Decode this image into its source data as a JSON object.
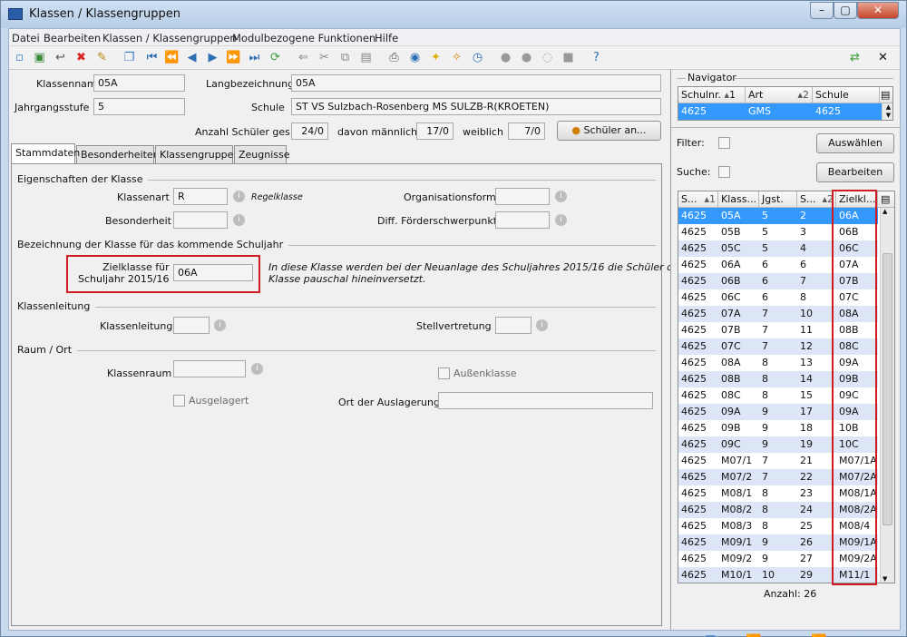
{
  "window": {
    "title": "Klassen / Klassengruppen"
  },
  "menu": [
    "Datei",
    "Bearbeiten",
    "Klassen / Klassengruppen",
    "Modulbezogene Funktionen",
    "Hilfe"
  ],
  "header": {
    "klassenname_label": "Klassenname",
    "klassenname": "05A",
    "langbezeichnung_label": "Langbezeichnung",
    "langbezeichnung": "05A",
    "jahrgangsstufe_label": "Jahrgangsstufe",
    "jahrgangsstufe": "5",
    "schule_label": "Schule",
    "schule": "ST VS Sulzbach-Rosenberg MS SULZB-R(KROETEN)",
    "anzahl_label": "Anzahl Schüler ges.",
    "anzahl": "24/0",
    "maennlich_label": "davon männlich",
    "maennlich": "17/0",
    "weiblich_label": "weiblich",
    "weiblich": "7/0",
    "schueler_button": "Schüler an..."
  },
  "tabs": [
    "Stammdaten",
    "Besonderheiten",
    "Klassengruppen",
    "Zeugnisse"
  ],
  "stamm": {
    "sec1": "Eigenschaften der Klasse",
    "klassenart_label": "Klassenart",
    "klassenart": "R",
    "klassenart_text": "Regelklasse",
    "orgform_label": "Organisationsform",
    "besonderheit_label": "Besonderheit",
    "foerder_label": "Diff. Förderschwerpunkt",
    "sec2": "Bezeichnung der Klasse für das kommende Schuljahr",
    "ziel_label1": "Zielklasse für",
    "ziel_label2": "Schuljahr 2015/16",
    "zielklasse": "06A",
    "ziel_note1": "In diese Klasse werden bei der Neuanlage des Schuljahres 2015/16 die Schüler dieser",
    "ziel_note2": "Klasse pauschal hineinversetzt.",
    "sec3": "Klassenleitung",
    "klassenleitung_label": "Klassenleitung",
    "stellvertretung_label": "Stellvertretung",
    "sec4": "Raum / Ort",
    "klassenraum_label": "Klassenraum",
    "aussenklasse_label": "Außenklasse",
    "ausgelagert_label": "Ausgelagert",
    "ort_label": "Ort der Auslagerung"
  },
  "navigator": {
    "title": "Navigator",
    "cols": [
      "Schulnr.",
      "1",
      "Art",
      "2",
      "Schule"
    ],
    "row": [
      "4625",
      "GMS",
      "4625"
    ],
    "filter_label": "Filter:",
    "filter_button": "Auswählen",
    "suche_label": "Suche:",
    "suche_button": "Bearbeiten",
    "list_cols": [
      "S...",
      "1",
      "Klass...",
      "Jgst.",
      "S...",
      "2",
      "Zielkl..."
    ],
    "rows": [
      [
        "4625",
        "05A",
        "5",
        "2",
        "06A"
      ],
      [
        "4625",
        "05B",
        "5",
        "3",
        "06B"
      ],
      [
        "4625",
        "05C",
        "5",
        "4",
        "06C"
      ],
      [
        "4625",
        "06A",
        "6",
        "6",
        "07A"
      ],
      [
        "4625",
        "06B",
        "6",
        "7",
        "07B"
      ],
      [
        "4625",
        "06C",
        "6",
        "8",
        "07C"
      ],
      [
        "4625",
        "07A",
        "7",
        "10",
        "08A"
      ],
      [
        "4625",
        "07B",
        "7",
        "11",
        "08B"
      ],
      [
        "4625",
        "07C",
        "7",
        "12",
        "08C"
      ],
      [
        "4625",
        "08A",
        "8",
        "13",
        "09A"
      ],
      [
        "4625",
        "08B",
        "8",
        "14",
        "09B"
      ],
      [
        "4625",
        "08C",
        "8",
        "15",
        "09C"
      ],
      [
        "4625",
        "09A",
        "9",
        "17",
        "09A"
      ],
      [
        "4625",
        "09B",
        "9",
        "18",
        "10B"
      ],
      [
        "4625",
        "09C",
        "9",
        "19",
        "10C"
      ],
      [
        "4625",
        "M07/1",
        "7",
        "21",
        "M07/1A"
      ],
      [
        "4625",
        "M07/2",
        "7",
        "22",
        "M07/2A"
      ],
      [
        "4625",
        "M08/1",
        "8",
        "23",
        "M08/1A"
      ],
      [
        "4625",
        "M08/2",
        "8",
        "24",
        "M08/2A"
      ],
      [
        "4625",
        "M08/3",
        "8",
        "25",
        "M08/4"
      ],
      [
        "4625",
        "M09/1",
        "9",
        "26",
        "M09/1A"
      ],
      [
        "4625",
        "M09/2",
        "9",
        "27",
        "M09/2A"
      ],
      [
        "4625",
        "M10/1",
        "10",
        "29",
        "M11/1"
      ]
    ],
    "anzahl": "Anzahl: 26"
  },
  "colors": {
    "selection": "#3399ff",
    "stripe": "#dce6f7",
    "highlight": "#d11a22"
  }
}
